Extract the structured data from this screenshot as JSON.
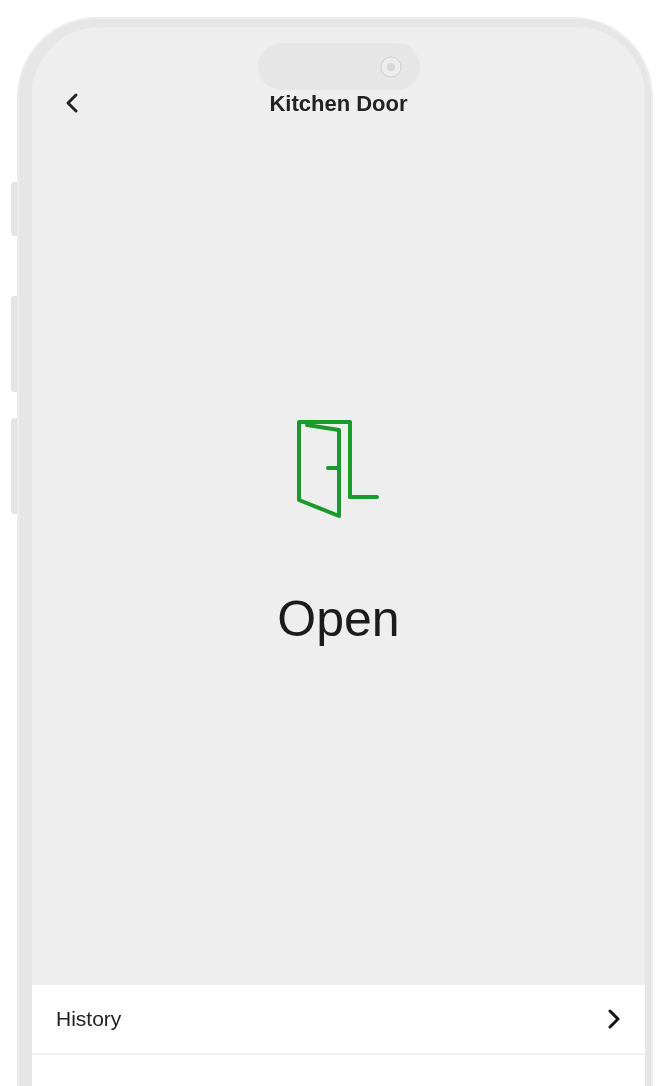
{
  "header": {
    "title": "Kitchen Door"
  },
  "status": {
    "label": "Open",
    "open": true
  },
  "menu": [
    {
      "label": "History"
    }
  ]
}
